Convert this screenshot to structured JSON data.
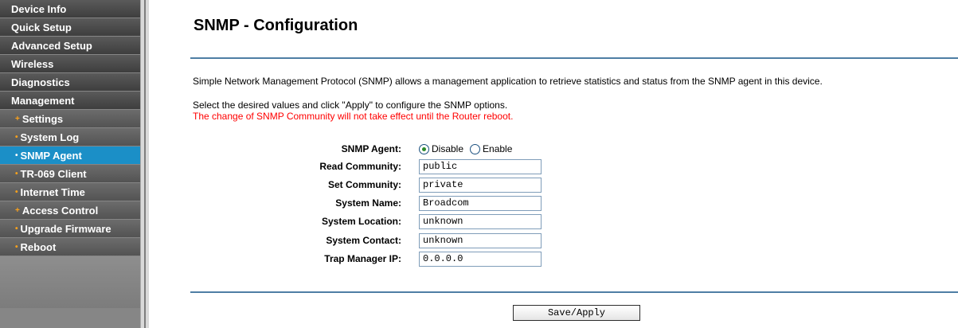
{
  "sidebar": {
    "items": [
      {
        "label": "Device Info",
        "level": "top"
      },
      {
        "label": "Quick Setup",
        "level": "top"
      },
      {
        "label": "Advanced Setup",
        "level": "top"
      },
      {
        "label": "Wireless",
        "level": "top"
      },
      {
        "label": "Diagnostics",
        "level": "top"
      },
      {
        "label": "Management",
        "level": "top"
      },
      {
        "label": "Settings",
        "level": "sub",
        "bullet": "+"
      },
      {
        "label": "System Log",
        "level": "sub",
        "bullet": "•"
      },
      {
        "label": "SNMP Agent",
        "level": "sub",
        "bullet": "•",
        "active": true
      },
      {
        "label": "TR-069 Client",
        "level": "sub",
        "bullet": "•"
      },
      {
        "label": "Internet Time",
        "level": "sub",
        "bullet": "•"
      },
      {
        "label": "Access Control",
        "level": "sub",
        "bullet": "+"
      },
      {
        "label": "Upgrade Firmware",
        "level": "sub",
        "bullet": "•"
      },
      {
        "label": "Reboot",
        "level": "sub",
        "bullet": "•"
      }
    ]
  },
  "main": {
    "title": "SNMP - Configuration",
    "description": "Simple Network Management Protocol (SNMP) allows a management application to retrieve statistics and status from the SNMP agent in this device.",
    "instruction": "Select the desired values and click \"Apply\" to configure the SNMP options.",
    "warning": "The change of SNMP Community will not take effect until the Router reboot.",
    "warning_color": "#ff0000",
    "active_color": "#1b8fc7"
  },
  "form": {
    "agent_label": "SNMP Agent:",
    "agent_options": [
      "Disable",
      "Enable"
    ],
    "agent_selected": "Disable",
    "fields": [
      {
        "label": "Read Community:",
        "value": "public"
      },
      {
        "label": "Set Community:",
        "value": "private"
      },
      {
        "label": "System Name:",
        "value": "Broadcom"
      },
      {
        "label": "System Location:",
        "value": "unknown"
      },
      {
        "label": "System Contact:",
        "value": "unknown"
      },
      {
        "label": "Trap Manager IP:",
        "value": "0.0.0.0"
      }
    ],
    "save_label": "Save/Apply"
  }
}
